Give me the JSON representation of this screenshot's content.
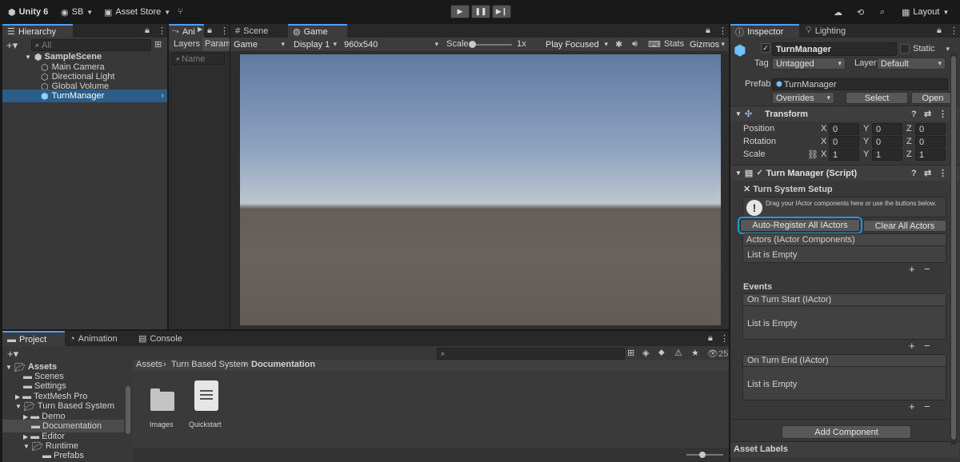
{
  "toolbar": {
    "app_name": "Unity 6",
    "account": "SB",
    "asset_store": "Asset Store",
    "layout": "Layout",
    "colors": {
      "accent": "#4d9eff"
    }
  },
  "hierarchy": {
    "tab": "Hierarchy",
    "search_placeholder": "All",
    "scene": "SampleScene",
    "items": [
      "Main Camera",
      "Directional Light",
      "Global Volume",
      "TurnManager"
    ]
  },
  "animator": {
    "tab": "Ani",
    "layers": "Layers",
    "parameters": "Parame",
    "name_placeholder": "Name"
  },
  "scene_tabs": {
    "scene": "Scene",
    "game": "Game"
  },
  "game_bar": {
    "mode": "Game",
    "display": "Display 1",
    "resolution": "960x540",
    "scale_label": "Scale",
    "scale_value": "1x",
    "play_mode": "Play Focused",
    "stats": "Stats",
    "gizmos": "Gizmos"
  },
  "project": {
    "tabs": [
      "Project",
      "Animation",
      "Console"
    ],
    "badge_count": "25",
    "tree": [
      {
        "label": "Assets",
        "bold": true
      },
      {
        "label": "Scenes"
      },
      {
        "label": "Settings"
      },
      {
        "label": "TextMesh Pro"
      },
      {
        "label": "Turn Based System"
      },
      {
        "label": "Demo"
      },
      {
        "label": "Documentation"
      },
      {
        "label": "Editor"
      },
      {
        "label": "Runtime"
      },
      {
        "label": "Prefabs"
      }
    ],
    "breadcrumb": [
      "Assets",
      "Turn Based System",
      "Documentation"
    ],
    "files": [
      "Images",
      "Quickstart"
    ]
  },
  "inspector": {
    "tabs": [
      "Inspector",
      "Lighting"
    ],
    "object_name": "TurnManager",
    "static_label": "Static",
    "tag_label": "Tag",
    "tag_value": "Untagged",
    "layer_label": "Layer",
    "layer_value": "Default",
    "prefab_label": "Prefab",
    "prefab_value": "TurnManager",
    "overrides": "Overrides",
    "select": "Select",
    "open": "Open",
    "transform": {
      "title": "Transform",
      "position": "Position",
      "rotation": "Rotation",
      "scale": "Scale",
      "axis_x": "X",
      "axis_y": "Y",
      "axis_z": "Z",
      "pos": [
        "0",
        "0",
        "0"
      ],
      "rot": [
        "0",
        "0",
        "0"
      ],
      "scl": [
        "1",
        "1",
        "1"
      ]
    },
    "script": {
      "title": "Turn Manager (Script)",
      "section": "Turn System Setup",
      "help": "Drag your IActor components here or use the buttons below.",
      "auto_register": "Auto-Register All IActors",
      "clear_all": "Clear All Actors",
      "actors_header": "Actors (IActor Components)",
      "list_empty": "List is Empty",
      "events": "Events",
      "on_turn_start": "On Turn Start (IActor)",
      "on_turn_end": "On Turn End (IActor)",
      "plus": "+",
      "minus": "−"
    },
    "add_component": "Add Component",
    "asset_labels": "Asset Labels"
  }
}
